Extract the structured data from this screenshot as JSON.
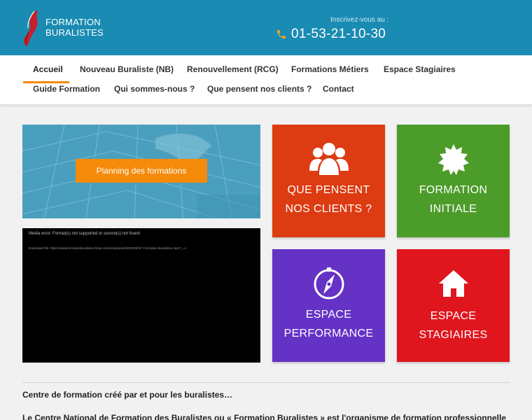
{
  "header": {
    "logo_line1": "FORMATION",
    "logo_line2": "BURALISTES",
    "signup_label": "Inscrivez-vous au :",
    "phone": "01-53-21-10-30"
  },
  "nav": {
    "row1": [
      "Accueil",
      "Nouveau Buraliste (NB)",
      "Renouvellement (RCG)",
      "Formations Métiers",
      "Espace Stagiaires"
    ],
    "row2": [
      "Guide Formation",
      "Qui sommes-nous ?",
      "Que pensent nos clients ?",
      "Contact"
    ]
  },
  "banner": {
    "button": "Planning des formations"
  },
  "video": {
    "error": "Media error: Format(s) not supported or source(s) not found",
    "download": "Download File: https://www.formationburalistes.fr/wp-content/uploads/2022/06/VF-Formation-Buralistes.mp4?_=1"
  },
  "tiles": [
    {
      "line1": "QUE PENSENT",
      "line2": "NOS CLIENTS ?",
      "icon": "users-icon",
      "color": "#dd3b12"
    },
    {
      "line1": "FORMATION",
      "line2": "INITIALE",
      "icon": "badge-icon",
      "color": "#4c9c2a"
    },
    {
      "line1": "ESPACE",
      "line2": "PERFORMANCE",
      "icon": "compass-icon",
      "color": "#6532c6"
    },
    {
      "line1": "ESPACE",
      "line2": "STAGIAIRES",
      "icon": "home-icon",
      "color": "#e0161e"
    }
  ],
  "content": {
    "title": "Centre de formation créé par et pour les buralistes…",
    "text": "Le Centre National de Formation des Buralistes ou « Formation Buralistes » est l'organisme de formation professionnelle"
  },
  "colors": {
    "header": "#1a8bb2",
    "accent": "#f58a0b"
  }
}
